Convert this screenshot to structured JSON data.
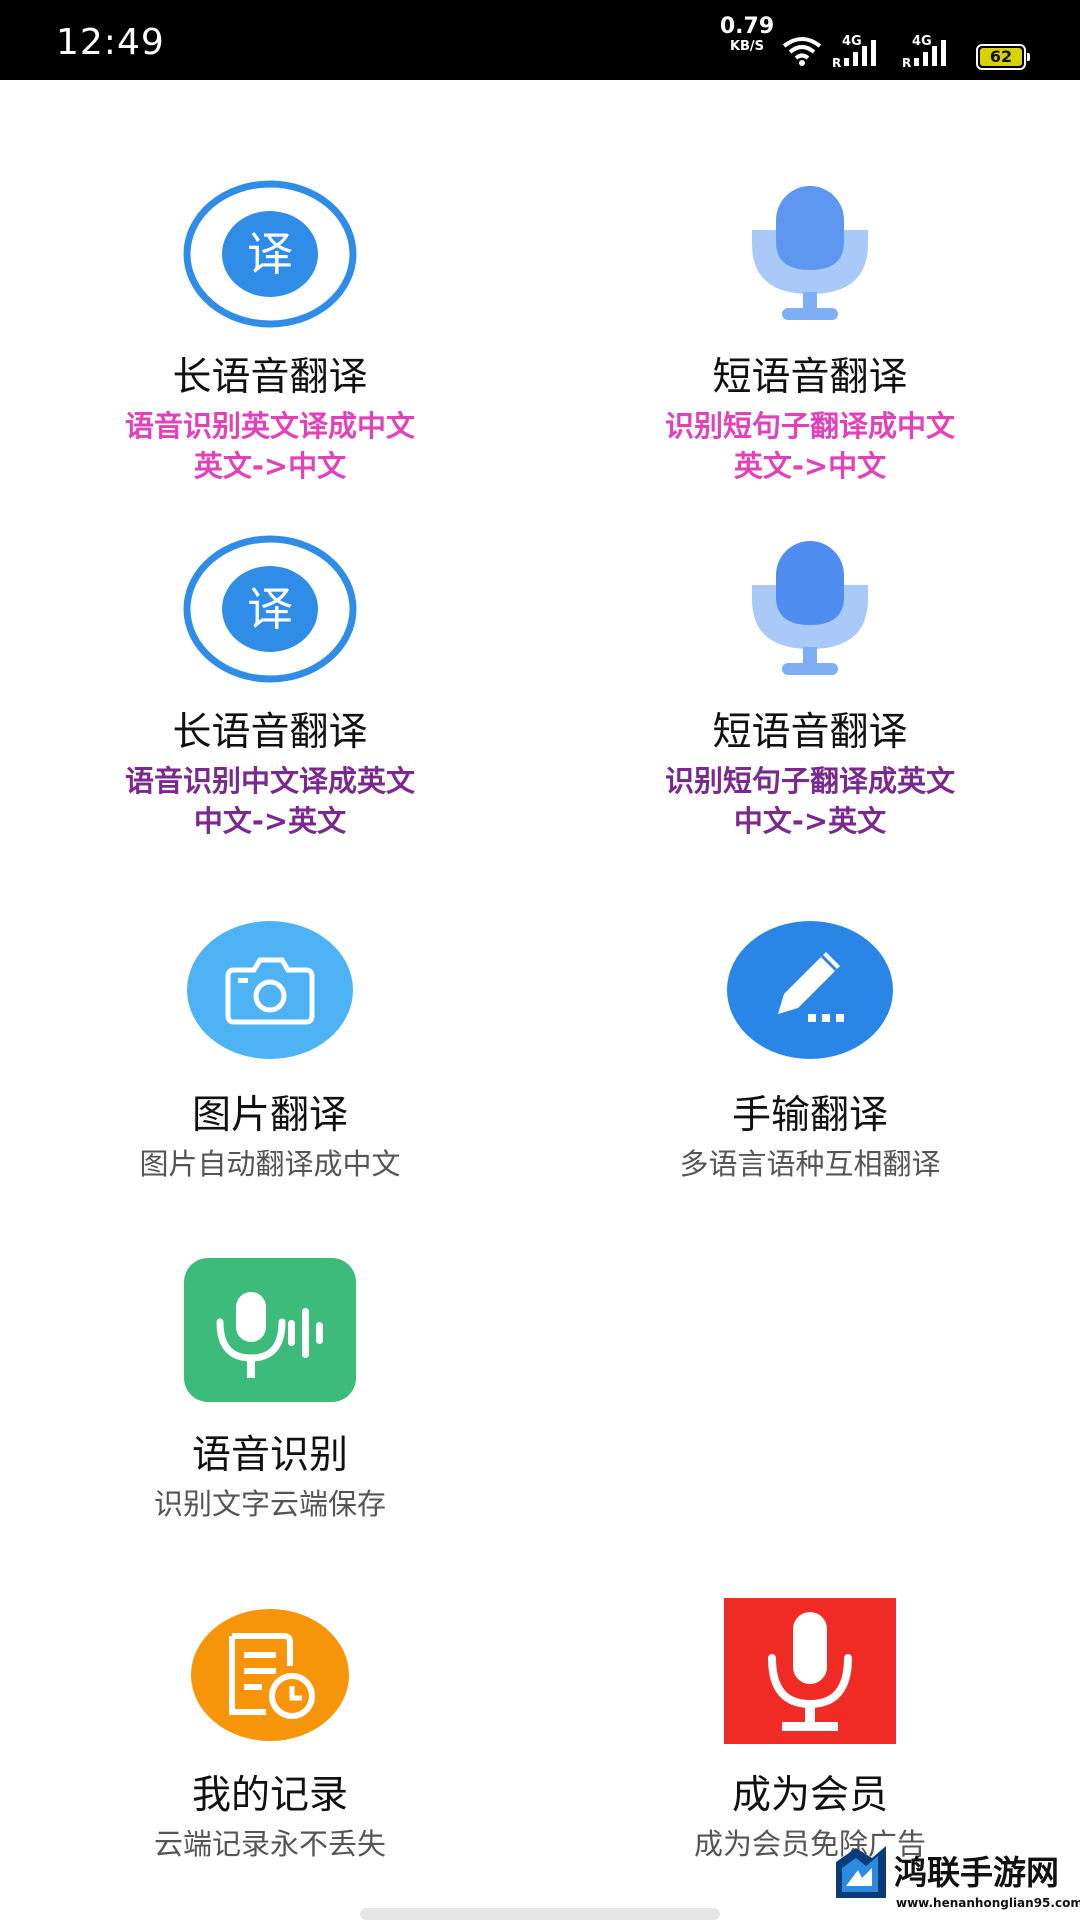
{
  "status_bar": {
    "time": "12:49",
    "net_speed": "0.79",
    "net_unit": "KB/S",
    "sim1_label": "4G",
    "sim2_label": "4G",
    "roaming_label": "R",
    "battery": "62"
  },
  "features": [
    {
      "title": "长语音翻译",
      "line1": "语音识别英文译成中文",
      "line2": "英文->中文",
      "icon": "translate-icon"
    },
    {
      "title": "短语音翻译",
      "line1": "识别短句子翻译成中文",
      "line2": "英文->中文",
      "icon": "microphone-icon"
    },
    {
      "title": "长语音翻译",
      "line1": "语音识别中文译成英文",
      "line2": "中文->英文",
      "icon": "translate-icon"
    },
    {
      "title": "短语音翻译",
      "line1": "识别短句子翻译成英文",
      "line2": "中文->英文",
      "icon": "microphone-icon"
    },
    {
      "title": "图片翻译",
      "line1": "图片自动翻译成中文",
      "icon": "camera-icon"
    },
    {
      "title": "手输翻译",
      "line1": "多语言语种互相翻译",
      "icon": "pencil-icon"
    },
    {
      "title": "语音识别",
      "line1": "识别文字云端保存",
      "icon": "voice-wave-icon"
    },
    {
      "title": "我的记录",
      "line1": "云端记录永不丢失",
      "icon": "history-document-icon"
    },
    {
      "title": "成为会员",
      "line1": "成为会员免除广告",
      "icon": "red-microphone-icon"
    }
  ],
  "colors": {
    "pink_subtitle": "#e341b8",
    "purple_subtitle": "#7a2a8e",
    "gray_subtitle": "#555555",
    "translate_blue": "#2f8de8",
    "mic_blue": "#6ea6f5",
    "camera_blue": "#4db3f5",
    "pencil_blue": "#2a86e6",
    "voice_green": "#3dbb7b",
    "record_orange": "#f7950a",
    "member_red": "#f02a25"
  },
  "watermark": {
    "text": "鸿联手游网",
    "url": "www.henanhonglian95.com"
  }
}
